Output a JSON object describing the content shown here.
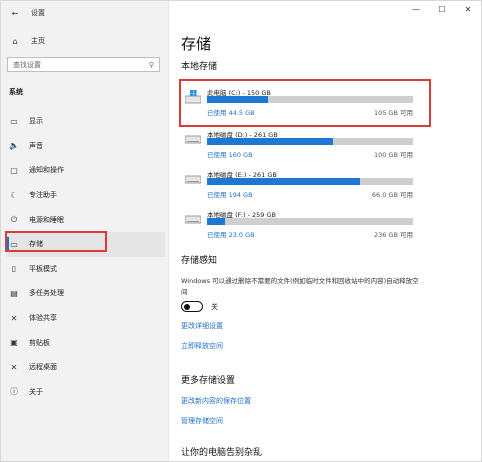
{
  "window": {
    "app_title": "设置",
    "controls": [
      "—",
      "☐",
      "✕"
    ]
  },
  "sidebar": {
    "home": "主页",
    "search_placeholder": "查找设置",
    "group": "系统",
    "items": [
      {
        "label": "显示",
        "icon": "display-icon",
        "glyph": "▭"
      },
      {
        "label": "声音",
        "icon": "sound-icon",
        "glyph": "🔈"
      },
      {
        "label": "通知和操作",
        "icon": "notification-icon",
        "glyph": "▢"
      },
      {
        "label": "专注助手",
        "icon": "focus-assist-icon",
        "glyph": "☾"
      },
      {
        "label": "电源和睡眠",
        "icon": "power-icon",
        "glyph": "⏻"
      },
      {
        "label": "存储",
        "icon": "storage-icon",
        "glyph": "▭",
        "active": true
      },
      {
        "label": "平板模式",
        "icon": "tablet-icon",
        "glyph": "▯"
      },
      {
        "label": "多任务处理",
        "icon": "multitask-icon",
        "glyph": "▤"
      },
      {
        "label": "体验共享",
        "icon": "share-icon",
        "glyph": "✕"
      },
      {
        "label": "剪贴板",
        "icon": "clipboard-icon",
        "glyph": "▣"
      },
      {
        "label": "远程桌面",
        "icon": "remote-desktop-icon",
        "glyph": "✕"
      },
      {
        "label": "关于",
        "icon": "about-icon",
        "glyph": "ⓘ"
      }
    ]
  },
  "main": {
    "title": "存储",
    "local_storage": "本地存储",
    "drives": [
      {
        "name": "此电脑 (C:) - 150 GB",
        "used": "已使用 44.5 GB",
        "free": "105 GB 可用",
        "fraction": 0.297,
        "icon": "windows-drive-icon"
      },
      {
        "name": "本地磁盘 (D:) - 261 GB",
        "used": "已使用 160 GB",
        "free": "100 GB 可用",
        "fraction": 0.613,
        "icon": "disk-drive-icon"
      },
      {
        "name": "本地磁盘 (E:) - 261 GB",
        "used": "已使用 194 GB",
        "free": "66.0 GB 可用",
        "fraction": 0.745,
        "icon": "disk-drive-icon"
      },
      {
        "name": "本地磁盘 (F:) - 259 GB",
        "used": "已使用 23.0 GB",
        "free": "236 GB 可用",
        "fraction": 0.089,
        "icon": "disk-drive-icon"
      }
    ],
    "storage_sense": "存储感知",
    "storage_sense_desc": "Windows 可以通过删除不需要的文件(例如临时文件和回收站中的内容)自动释放空间",
    "toggle_state": "关",
    "toggle_on": false,
    "link_configure": "更改详细设置",
    "link_free_now": "立即释放空间",
    "more_settings": "更多存储设置",
    "link_save_location": "更改新内容的保存位置",
    "link_manage_spaces": "管理存储空间",
    "tidy_section": "让你的电脑告别杂乱"
  },
  "colors": {
    "accent": "#1e78d2",
    "highlight": "#d93a3a",
    "link": "#1e6fc8"
  }
}
